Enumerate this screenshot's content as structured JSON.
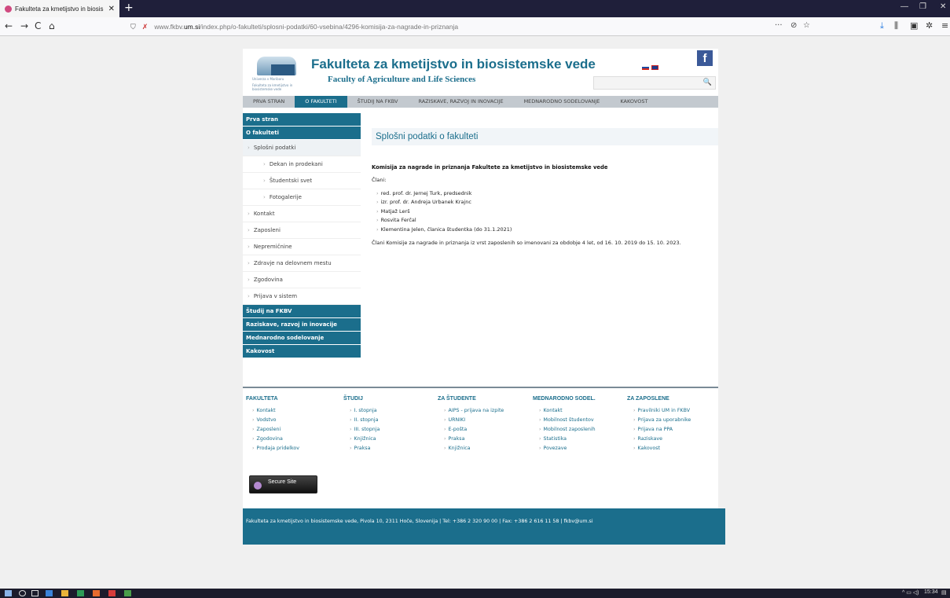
{
  "browser": {
    "tab_title": "Fakulteta za kmetijstvo in biosis",
    "url_prefix": "www.fkbv.",
    "url_host": "um.si",
    "url_path": "/index.php/o-fakulteti/splosni-podatki/60-vsebina/4296-komisija-za-nagrade-in-priznanja",
    "new_tab": "+",
    "back": "←",
    "forward": "→",
    "reload": "C",
    "home": "⌂",
    "url_more": "···",
    "pocket": "⊘",
    "bookmark": "☆"
  },
  "header": {
    "title": "Fakulteta za kmetijstvo in biosistemske vede",
    "subtitle": "Faculty of Agriculture and Life Sciences",
    "logo_line1": "Univerza v Mariboru",
    "logo_line2": "Fakulteta za kmetijstvo in biosistemske vede",
    "facebook": "f"
  },
  "mainnav": [
    "PRVA STRAN",
    "O FAKULTETI",
    "ŠTUDIJ NA FKBV",
    "RAZISKAVE, RAZVOJ IN INOVACIJE",
    "MEDNARODNO SODELOVANJE",
    "KAKOVOST"
  ],
  "sidebar": {
    "prva": "Prva stran",
    "ofak": "O fakulteti",
    "splosni": "Splošni podatki",
    "dekan": "Dekan in prodekani",
    "studsvet": "Študentski svet",
    "foto": "Fotogalerije",
    "kontakt": "Kontakt",
    "zaposleni": "Zaposleni",
    "nepremicnine": "Nepremičnine",
    "zdravje": "Zdravje na delovnem mestu",
    "zgodovina": "Zgodovina",
    "prijava": "Prijava v sistem",
    "studij": "Študij na FKBV",
    "raziskave": "Raziskave, razvoj in inovacije",
    "mednarodno": "Mednarodno sodelovanje",
    "kakovost": "Kakovost"
  },
  "content": {
    "title": "Splošni podatki o fakulteti",
    "heading": "Komisija za nagrade in priznanja Fakultete za kmetijstvo in biosistemske vede",
    "members_label": "Člani:",
    "members": [
      "red. prof. dr. Jernej Turk, predsednik",
      "izr. prof. dr. Andreja Urbanek Krajnc",
      "Matjaž Lerš",
      "Rosvita Ferčal",
      "Klementina Jelen, članica študentka (do 31.1.2021)"
    ],
    "note": "Člani Komisije za nagrade in priznanja iz vrst zaposlenih so imenovani za obdobje 4 let, od 16. 10. 2019 do 15. 10. 2023."
  },
  "footer": {
    "cols": [
      {
        "head": "FAKULTETA",
        "items": [
          "Kontakt",
          "Vodstvo",
          "Zaposleni",
          "Zgodovina",
          "Prodaja pridelkov"
        ]
      },
      {
        "head": "ŠTUDIJ",
        "items": [
          "I. stopnja",
          "II. stopnja",
          "III. stopnja",
          "Knjižnica",
          "Praksa"
        ]
      },
      {
        "head": "ZA ŠTUDENTE",
        "items": [
          "AIPS - prijava na izpite",
          "URNIKI",
          "E-pošta",
          "Praksa",
          "Knjižnica"
        ]
      },
      {
        "head": "MEDNARODNO SODEL.",
        "items": [
          "Kontakt",
          "Mobilnost študentov",
          "Mobilnost zaposlenih",
          "Statistika",
          "Povezave"
        ]
      },
      {
        "head": "ZA ZAPOSLENE",
        "items": [
          "Pravilniki UM in FKBV",
          "Prijava za uporabnike",
          "Prijava na PPA",
          "Raziskave",
          "Kakovost"
        ]
      }
    ],
    "secure": "Secure Site",
    "address": "Fakulteta za kmetijstvo in biosistemske vede, Pivola 10, 2311 Hoče, Slovenija | Tel: +386 2 320 90 00 | Fax: +386 2 616 11 58 | fkbv@um.si"
  },
  "taskbar": {
    "time": "15:34"
  }
}
